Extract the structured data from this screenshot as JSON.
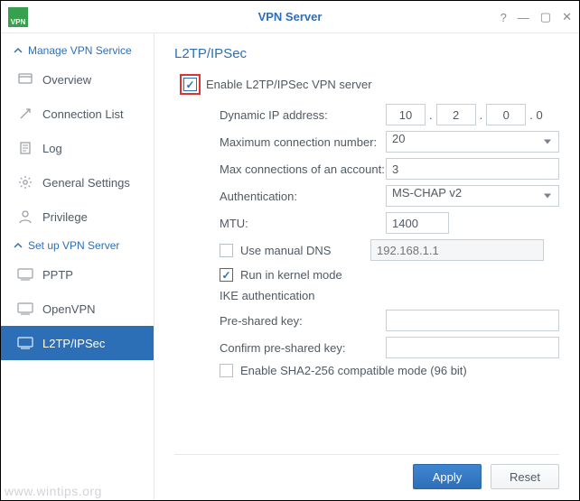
{
  "titlebar": {
    "title": "VPN Server",
    "app_icon_text": "VPN"
  },
  "sidebar": {
    "section1": {
      "label": "Manage VPN Service"
    },
    "items1": [
      {
        "label": "Overview"
      },
      {
        "label": "Connection List"
      },
      {
        "label": "Log"
      },
      {
        "label": "General Settings"
      },
      {
        "label": "Privilege"
      }
    ],
    "section2": {
      "label": "Set up VPN Server"
    },
    "items2": [
      {
        "label": "PPTP"
      },
      {
        "label": "OpenVPN"
      },
      {
        "label": "L2TP/IPSec"
      }
    ]
  },
  "page": {
    "title": "L2TP/IPSec",
    "enable_label": "Enable L2TP/IPSec VPN server",
    "fields": {
      "dyn_ip_label": "Dynamic IP address:",
      "dyn_ip": {
        "a": "10",
        "b": "2",
        "c": "0",
        "d_suffix": ". 0"
      },
      "max_conn_label": "Maximum connection number:",
      "max_conn_value": "20",
      "max_acc_label": "Max connections of an account:",
      "max_acc_value": "3",
      "auth_label": "Authentication:",
      "auth_value": "MS-CHAP v2",
      "mtu_label": "MTU:",
      "mtu_value": "1400",
      "manual_dns_label": "Use manual DNS",
      "manual_dns_placeholder": "192.168.1.1",
      "kernel_mode_label": "Run in kernel mode",
      "ike_header": "IKE authentication",
      "psk_label": "Pre-shared key:",
      "psk2_label": "Confirm pre-shared key:",
      "sha2_label": "Enable SHA2-256 compatible mode (96 bit)"
    }
  },
  "buttons": {
    "apply": "Apply",
    "reset": "Reset"
  },
  "watermark": "www.wintips.org"
}
